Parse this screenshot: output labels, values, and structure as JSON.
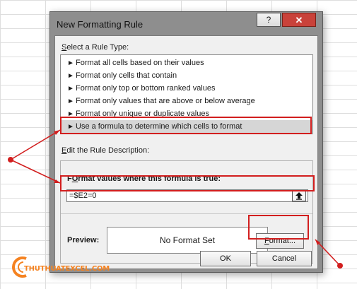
{
  "dialog": {
    "title": "New Formatting Rule",
    "help_label": "?",
    "close_label": "✕"
  },
  "rule_type": {
    "heading_key": "S",
    "heading_rest": "elect a Rule Type:",
    "items": [
      {
        "label": "Format all cells based on their values"
      },
      {
        "label": "Format only cells that contain"
      },
      {
        "label": "Format only top or bottom ranked values"
      },
      {
        "label": "Format only values that are above or below average"
      },
      {
        "label": "Format only unique or duplicate values"
      },
      {
        "label": "Use a formula to determine which cells to format",
        "selected": true
      }
    ]
  },
  "rule_description": {
    "heading_key": "E",
    "heading_rest": "dit the Rule Description:",
    "formula_label_key": "O",
    "formula_label_pre": "F",
    "formula_label_rest": "rmat values where this formula is true:",
    "formula_value": "=$E2=0",
    "preview_label": "Preview:",
    "preview_text": "No Format Set",
    "format_key": "F",
    "format_rest": "ormat..."
  },
  "buttons": {
    "ok": "OK",
    "cancel": "Cancel"
  },
  "watermark": {
    "text": "THUTHUATEXCEL.COM"
  },
  "colors": {
    "annotation_red": "#d21e1e",
    "selected_row": "#d6d6d6",
    "close_red": "#c9423a",
    "watermark_orange": "#f58220"
  }
}
